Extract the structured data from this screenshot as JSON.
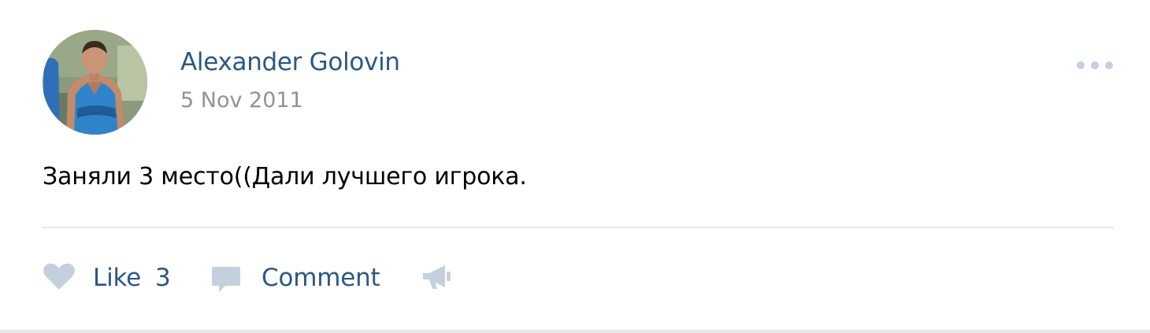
{
  "post": {
    "author": "Alexander Golovin",
    "date": "5 Nov 2011",
    "text": "Заняли 3 место((Дали лучшего игрока.",
    "actions": {
      "like_label": "Like",
      "like_count": "3",
      "comment_label": "Comment"
    }
  },
  "icons": {
    "more": "more-dots-icon",
    "like": "heart-icon",
    "comment": "comment-bubble-icon",
    "share": "megaphone-icon"
  },
  "colors": {
    "link": "#2a5885",
    "muted": "#939393",
    "icon": "#c4d0de",
    "divider": "#e7e8ec",
    "text": "#000000"
  }
}
